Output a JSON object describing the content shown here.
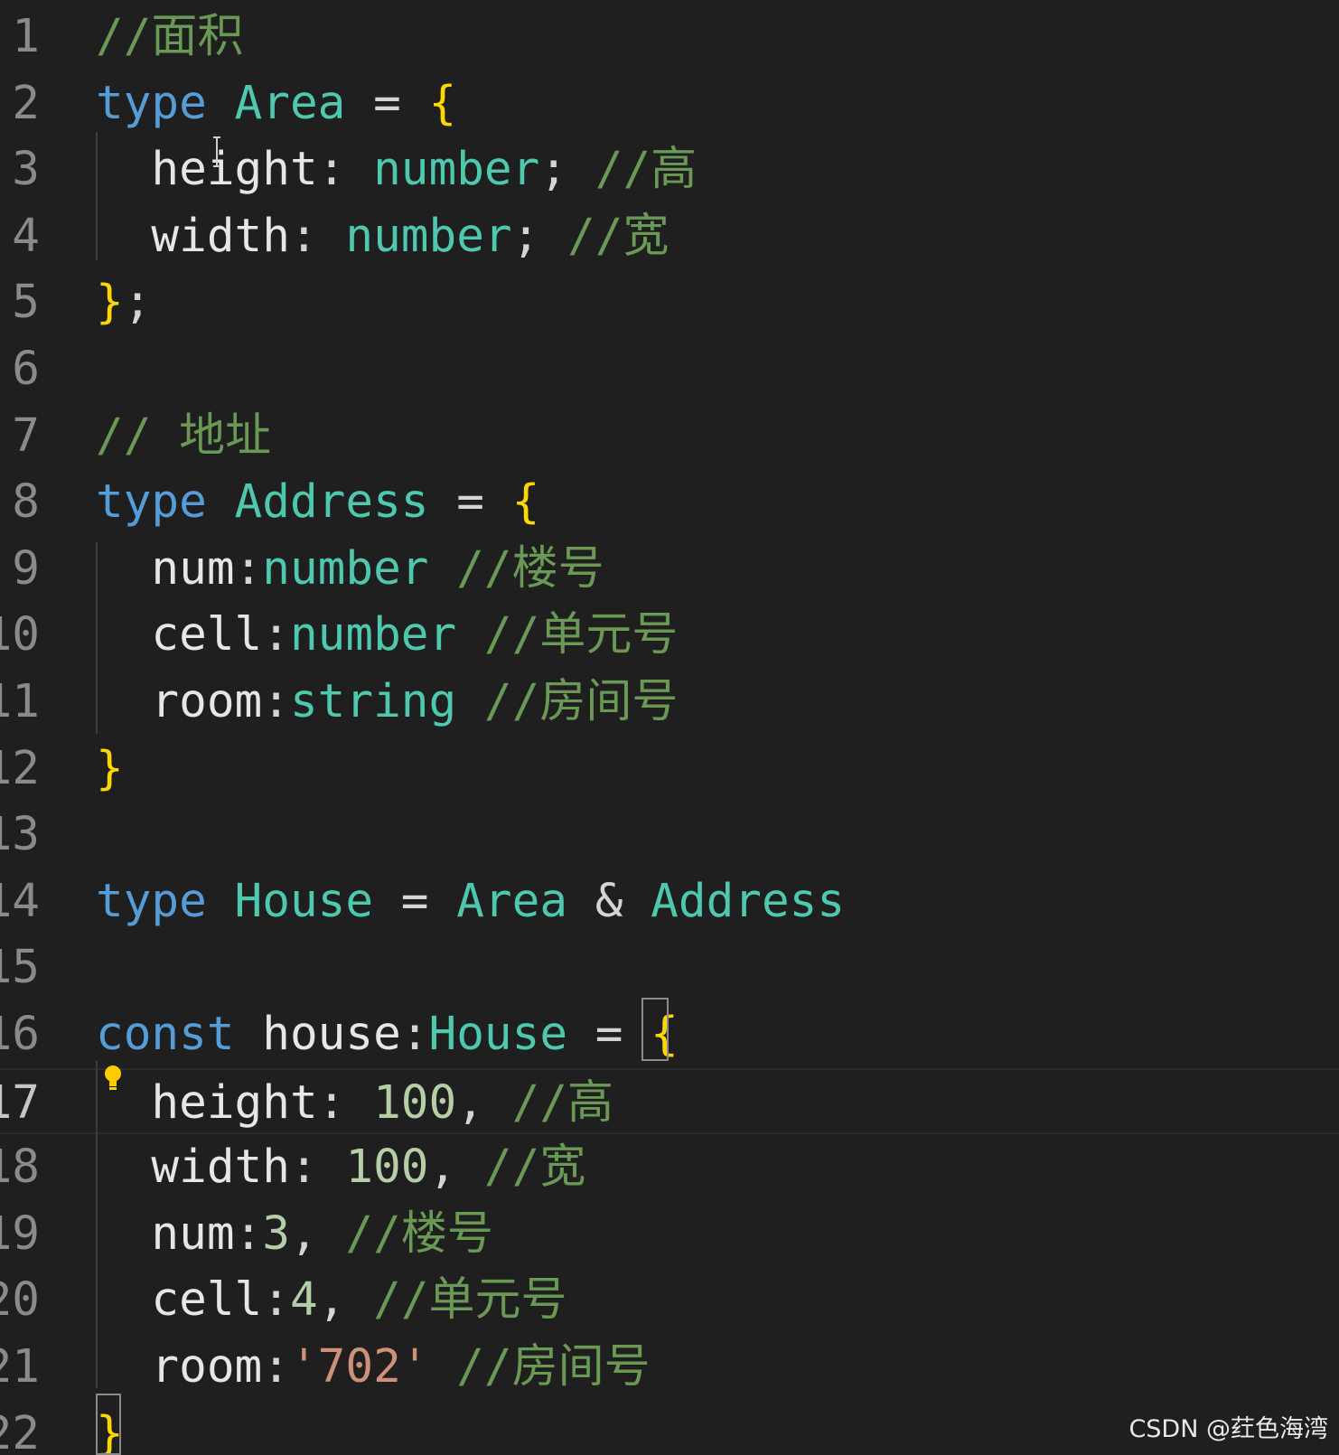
{
  "editor": {
    "lines": [
      {
        "num": "1",
        "tokens": [
          {
            "t": "//面积",
            "c": "cm"
          }
        ]
      },
      {
        "num": "2",
        "tokens": [
          {
            "t": "type",
            "c": "kw"
          },
          {
            "t": " ",
            "c": "op"
          },
          {
            "t": "Area",
            "c": "ty"
          },
          {
            "t": " = ",
            "c": "op"
          },
          {
            "t": "{",
            "c": "br"
          }
        ]
      },
      {
        "num": "3",
        "tokens": [
          {
            "t": "  ",
            "c": "op"
          },
          {
            "t": "height",
            "c": "pr"
          },
          {
            "t": ": ",
            "c": "op"
          },
          {
            "t": "number",
            "c": "ty"
          },
          {
            "t": "; ",
            "c": "op"
          },
          {
            "t": "//高",
            "c": "cm"
          }
        ]
      },
      {
        "num": "4",
        "tokens": [
          {
            "t": "  ",
            "c": "op"
          },
          {
            "t": "width",
            "c": "pr"
          },
          {
            "t": ": ",
            "c": "op"
          },
          {
            "t": "number",
            "c": "ty"
          },
          {
            "t": "; ",
            "c": "op"
          },
          {
            "t": "//宽",
            "c": "cm"
          }
        ]
      },
      {
        "num": "5",
        "tokens": [
          {
            "t": "}",
            "c": "br"
          },
          {
            "t": ";",
            "c": "op"
          }
        ]
      },
      {
        "num": "6",
        "tokens": []
      },
      {
        "num": "7",
        "tokens": [
          {
            "t": "// 地址",
            "c": "cm"
          }
        ]
      },
      {
        "num": "8",
        "tokens": [
          {
            "t": "type",
            "c": "kw"
          },
          {
            "t": " ",
            "c": "op"
          },
          {
            "t": "Address",
            "c": "ty"
          },
          {
            "t": " = ",
            "c": "op"
          },
          {
            "t": "{",
            "c": "br"
          }
        ]
      },
      {
        "num": "9",
        "tokens": [
          {
            "t": "  ",
            "c": "op"
          },
          {
            "t": "num",
            "c": "pr"
          },
          {
            "t": ":",
            "c": "op"
          },
          {
            "t": "number",
            "c": "ty"
          },
          {
            "t": " ",
            "c": "op"
          },
          {
            "t": "//楼号",
            "c": "cm"
          }
        ]
      },
      {
        "num": "10",
        "tokens": [
          {
            "t": "  ",
            "c": "op"
          },
          {
            "t": "cell",
            "c": "pr"
          },
          {
            "t": ":",
            "c": "op"
          },
          {
            "t": "number",
            "c": "ty"
          },
          {
            "t": " ",
            "c": "op"
          },
          {
            "t": "//单元号",
            "c": "cm"
          }
        ]
      },
      {
        "num": "11",
        "tokens": [
          {
            "t": "  ",
            "c": "op"
          },
          {
            "t": "room",
            "c": "pr"
          },
          {
            "t": ":",
            "c": "op"
          },
          {
            "t": "string",
            "c": "ty"
          },
          {
            "t": " ",
            "c": "op"
          },
          {
            "t": "//房间号",
            "c": "cm"
          }
        ]
      },
      {
        "num": "12",
        "tokens": [
          {
            "t": "}",
            "c": "br"
          }
        ]
      },
      {
        "num": "13",
        "tokens": []
      },
      {
        "num": "14",
        "tokens": [
          {
            "t": "type",
            "c": "kw"
          },
          {
            "t": " ",
            "c": "op"
          },
          {
            "t": "House",
            "c": "ty"
          },
          {
            "t": " = ",
            "c": "op"
          },
          {
            "t": "Area",
            "c": "ty"
          },
          {
            "t": " & ",
            "c": "op"
          },
          {
            "t": "Address",
            "c": "ty"
          }
        ]
      },
      {
        "num": "15",
        "tokens": []
      },
      {
        "num": "16",
        "tokens": [
          {
            "t": "const",
            "c": "kw"
          },
          {
            "t": " ",
            "c": "op"
          },
          {
            "t": "house",
            "c": "pr"
          },
          {
            "t": ":",
            "c": "op"
          },
          {
            "t": "House",
            "c": "ty"
          },
          {
            "t": " = ",
            "c": "op"
          },
          {
            "t": "{",
            "c": "br"
          }
        ]
      },
      {
        "num": "17",
        "tokens": [
          {
            "t": "  ",
            "c": "op"
          },
          {
            "t": "height",
            "c": "pr"
          },
          {
            "t": ": ",
            "c": "op"
          },
          {
            "t": "100",
            "c": "nu"
          },
          {
            "t": ", ",
            "c": "op"
          },
          {
            "t": "//高",
            "c": "cm"
          }
        ]
      },
      {
        "num": "18",
        "tokens": [
          {
            "t": "  ",
            "c": "op"
          },
          {
            "t": "width",
            "c": "pr"
          },
          {
            "t": ": ",
            "c": "op"
          },
          {
            "t": "100",
            "c": "nu"
          },
          {
            "t": ", ",
            "c": "op"
          },
          {
            "t": "//宽",
            "c": "cm"
          }
        ]
      },
      {
        "num": "19",
        "tokens": [
          {
            "t": "  ",
            "c": "op"
          },
          {
            "t": "num",
            "c": "pr"
          },
          {
            "t": ":",
            "c": "op"
          },
          {
            "t": "3",
            "c": "nu"
          },
          {
            "t": ", ",
            "c": "op"
          },
          {
            "t": "//楼号",
            "c": "cm"
          }
        ]
      },
      {
        "num": "20",
        "tokens": [
          {
            "t": "  ",
            "c": "op"
          },
          {
            "t": "cell",
            "c": "pr"
          },
          {
            "t": ":",
            "c": "op"
          },
          {
            "t": "4",
            "c": "nu"
          },
          {
            "t": ", ",
            "c": "op"
          },
          {
            "t": "//单元号",
            "c": "cm"
          }
        ]
      },
      {
        "num": "21",
        "tokens": [
          {
            "t": "  ",
            "c": "op"
          },
          {
            "t": "room",
            "c": "pr"
          },
          {
            "t": ":",
            "c": "op"
          },
          {
            "t": "'702'",
            "c": "st"
          },
          {
            "t": " ",
            "c": "op"
          },
          {
            "t": "//房间号",
            "c": "cm"
          }
        ]
      },
      {
        "num": "22",
        "tokens": [
          {
            "t": "}",
            "c": "br"
          }
        ]
      }
    ],
    "current_line": "17"
  },
  "watermark": {
    "text": "CSDN @荭色海湾"
  },
  "icons": {
    "lightbulb": "lightbulb-icon",
    "text_cursor": "i-beam-cursor-icon"
  },
  "colors": {
    "background": "#1f1f1f",
    "keyword": "#569cd6",
    "type": "#4ec9b0",
    "property": "#e6e6e6",
    "bracket": "#ffd700",
    "comment": "#6a9955",
    "number": "#b5cea8",
    "string": "#ce9178"
  }
}
